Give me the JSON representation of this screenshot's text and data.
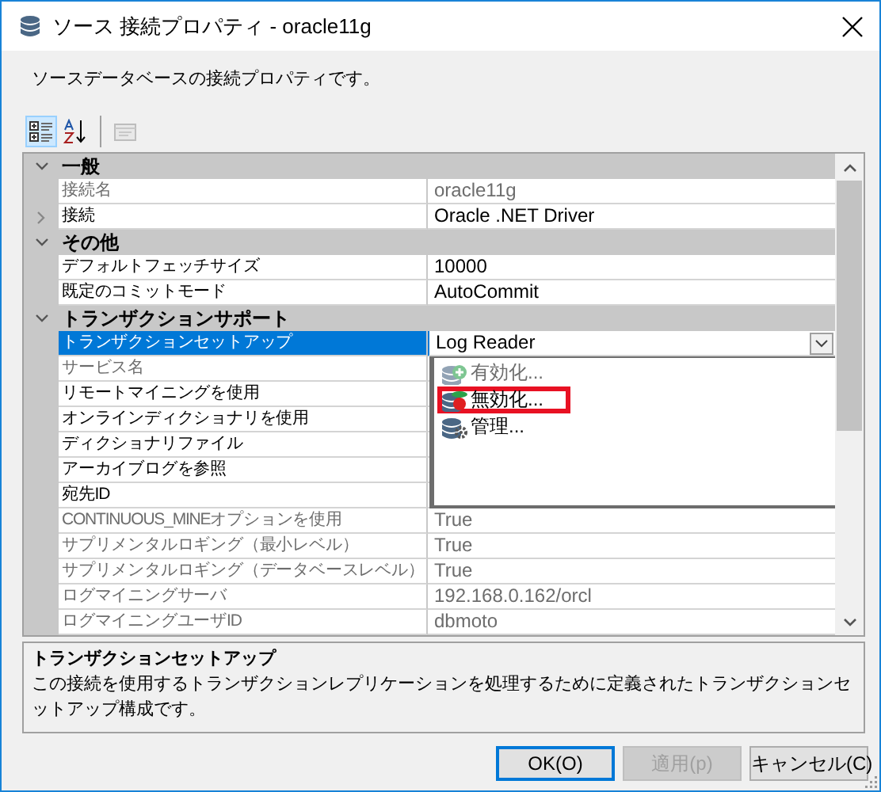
{
  "window": {
    "title": "ソース 接続プロパティ - oracle11g"
  },
  "description": "ソースデータベースの接続プロパティです。",
  "toolbar": [
    {
      "kind": "categorized",
      "selected": true,
      "disabled": false
    },
    {
      "kind": "alphabetical",
      "selected": false,
      "disabled": false
    },
    {
      "kind": "property-pages",
      "selected": false,
      "disabled": true
    }
  ],
  "property_grid": {
    "rows": [
      {
        "kind": "category",
        "name": "一般",
        "expanded": true
      },
      {
        "kind": "property",
        "name": "接続名",
        "value": "oracle11g",
        "disabled": true,
        "selected": false
      },
      {
        "kind": "property",
        "name": "接続",
        "value": "Oracle .NET Driver",
        "disabled": false,
        "selected": false,
        "expanded": false
      },
      {
        "kind": "category",
        "name": "その他",
        "expanded": true
      },
      {
        "kind": "property",
        "name": "デフォルトフェッチサイズ",
        "value": "10000",
        "disabled": false,
        "selected": false
      },
      {
        "kind": "property",
        "name": "既定のコミットモード",
        "value": "AutoCommit",
        "disabled": false,
        "selected": false
      },
      {
        "kind": "category",
        "name": "トランザクションサポート",
        "expanded": true
      },
      {
        "kind": "property",
        "name": "トランザクションセットアップ",
        "value": "Log Reader",
        "disabled": false,
        "selected": true,
        "dropdown": {
          "items": [
            {
              "kind": "enable",
              "label": "有効化...",
              "disabled": true,
              "highlighted": false
            },
            {
              "kind": "disable",
              "label": "無効化...",
              "disabled": false,
              "highlighted": true
            },
            {
              "kind": "manage",
              "label": "管理...",
              "disabled": false,
              "highlighted": false
            }
          ]
        }
      },
      {
        "kind": "property",
        "name": "サービス名",
        "disabled": true,
        "selected": false
      },
      {
        "kind": "property",
        "name": "リモートマイニングを使用",
        "disabled": false,
        "selected": false
      },
      {
        "kind": "property",
        "name": "オンラインディクショナリを使用",
        "disabled": false,
        "selected": false
      },
      {
        "kind": "property",
        "name": "ディクショナリファイル",
        "disabled": false,
        "selected": false
      },
      {
        "kind": "property",
        "name": "アーカイブログを参照",
        "disabled": false,
        "selected": false
      },
      {
        "kind": "property",
        "name": "宛先ID",
        "disabled": false,
        "selected": false
      },
      {
        "kind": "property",
        "name": "CONTINUOUS_MINEオプションを使用",
        "value": "True",
        "disabled": true,
        "selected": false
      },
      {
        "kind": "property",
        "name": "サプリメンタルロギング（最小レベル）",
        "value": "True",
        "disabled": true,
        "selected": false
      },
      {
        "kind": "property",
        "name": "サプリメンタルロギング（データベースレベル）",
        "value": "True",
        "disabled": true,
        "selected": false
      },
      {
        "kind": "property",
        "name": "ログマイニングサーバ",
        "value": "192.168.0.162/orcl",
        "disabled": true,
        "selected": false
      },
      {
        "kind": "property",
        "name": "ログマイニングユーザID",
        "value": "dbmoto",
        "disabled": true,
        "selected": false
      }
    ]
  },
  "help": {
    "title": "トランザクションセットアップ",
    "text": "この接続を使用するトランザクションレプリケーションを処理するために定義されたトランザクションセットアップ構成です。"
  },
  "buttons": [
    {
      "label": "OK(O)",
      "default": true,
      "disabled": false
    },
    {
      "label": "適用(p)",
      "default": false,
      "disabled": true
    },
    {
      "label": "キャンセル(C)",
      "default": false,
      "disabled": false
    }
  ]
}
